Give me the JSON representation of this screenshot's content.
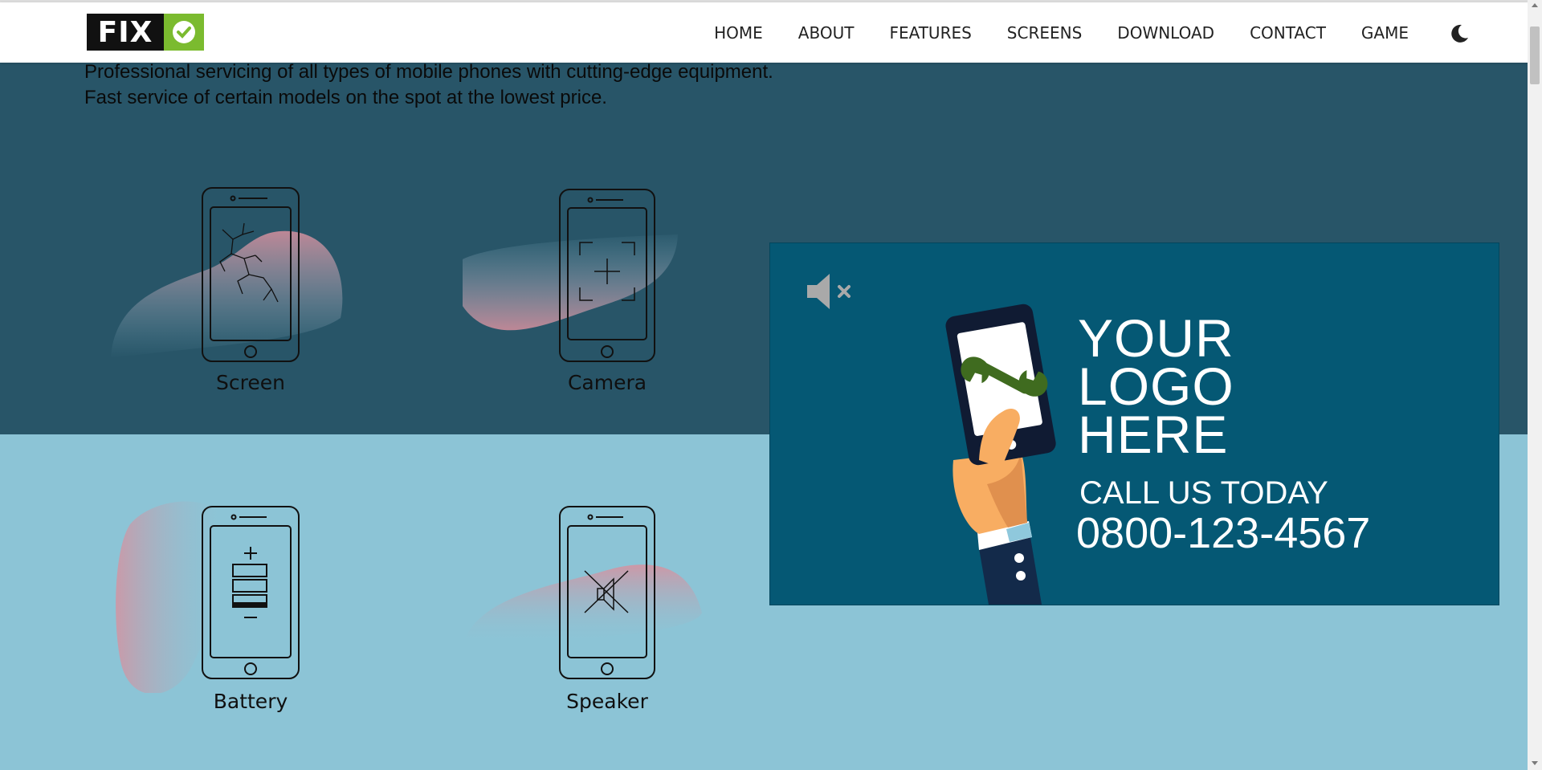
{
  "brand": {
    "logo_text": "FIX"
  },
  "nav": {
    "items": [
      "HOME",
      "ABOUT",
      "FEATURES",
      "SCREENS",
      "DOWNLOAD",
      "CONTACT",
      "GAME"
    ],
    "theme_toggle_icon": "moon-icon"
  },
  "intro": {
    "line1": "Professional servicing of all types of mobile phones with cutting-edge equipment.",
    "line2": "Fast service of certain models on the spot at the lowest price."
  },
  "services": [
    {
      "label": "Screen",
      "icon": "cracked-screen-icon"
    },
    {
      "label": "Camera",
      "icon": "camera-focus-icon"
    },
    {
      "label": "Battery",
      "icon": "battery-icon"
    },
    {
      "label": "Speaker",
      "icon": "speaker-muted-icon"
    }
  ],
  "ad": {
    "mute_icon": "volume-muted-icon",
    "logo_lines": [
      "YOUR",
      "LOGO",
      "HERE"
    ],
    "call_text": "CALL US TODAY",
    "phone": "0800-123-4567"
  },
  "colors": {
    "top_band": "#285568",
    "bottom_band": "#8cc4d6",
    "ad_background": "#055874",
    "logo_green": "#7bbb2f",
    "wrench_green": "#3f6b1f"
  }
}
